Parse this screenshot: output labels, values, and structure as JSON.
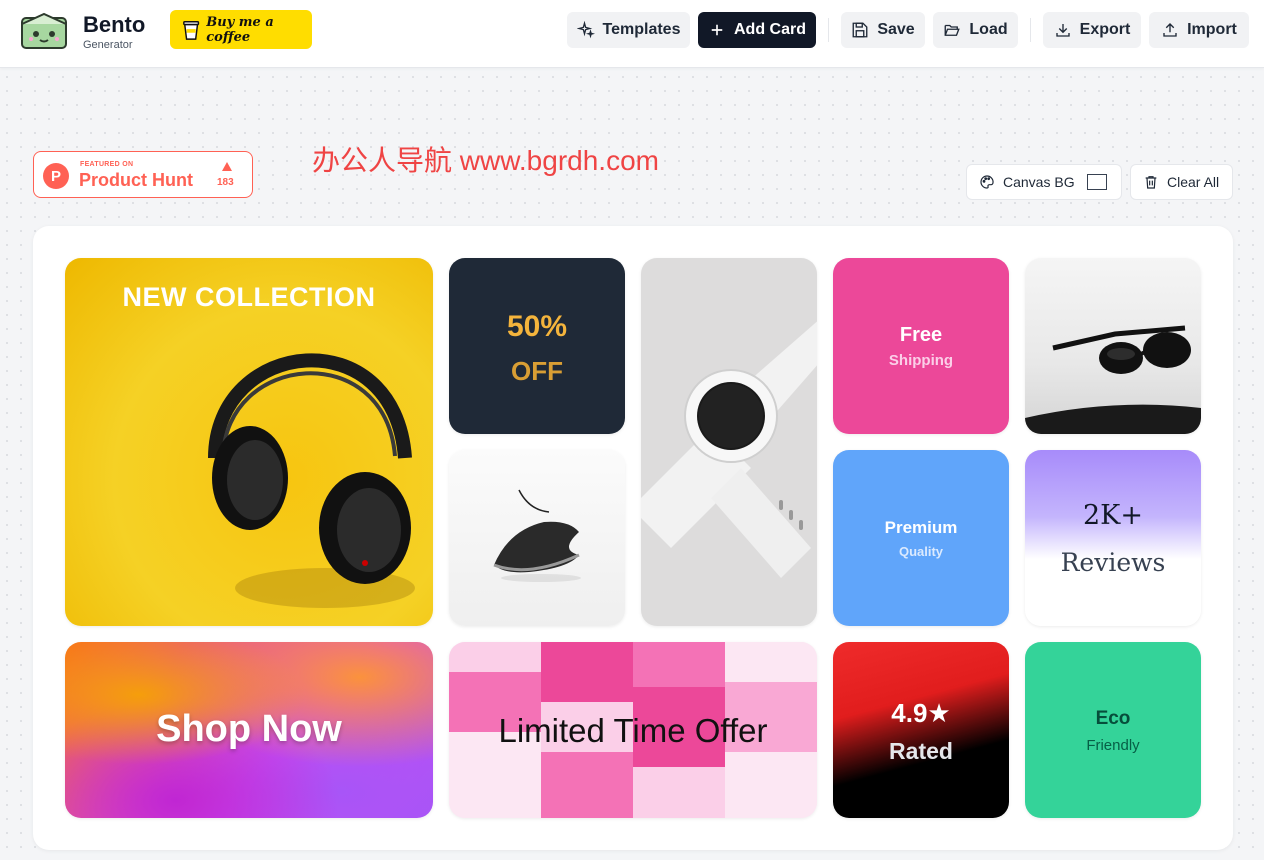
{
  "header": {
    "brand_title": "Bento",
    "brand_sub": "Generator",
    "coffee_label": "Buy me a coffee",
    "buttons": {
      "templates": "Templates",
      "add_card": "Add Card",
      "save": "Save",
      "load": "Load",
      "export": "Export",
      "import": "Import"
    }
  },
  "product_hunt": {
    "featured": "FEATURED ON",
    "name": "Product Hunt",
    "count": "183"
  },
  "watermark": "办公人导航 www.bgrdh.com",
  "toolbar": {
    "canvas_bg": "Canvas BG",
    "clear_all": "Clear All"
  },
  "cards": {
    "headphones": {
      "title": "NEW COLLECTION"
    },
    "sale": {
      "line1": "50%",
      "line2": "OFF"
    },
    "free": {
      "line1": "Free",
      "line2": "Shipping"
    },
    "premium": {
      "line1": "Premium",
      "line2": "Quality"
    },
    "reviews": {
      "line1": "2K+",
      "line2": "Reviews"
    },
    "shop": {
      "line1": "Shop Now"
    },
    "limited": {
      "line1": "Limited Time Offer"
    },
    "rated": {
      "line1": "4.9★",
      "line2": "Rated"
    },
    "eco": {
      "line1": "Eco",
      "line2": "Friendly"
    }
  },
  "colors": {
    "accent_dark": "#111827",
    "coffee_yellow": "#ffdd00",
    "product_hunt": "#ff6154"
  }
}
